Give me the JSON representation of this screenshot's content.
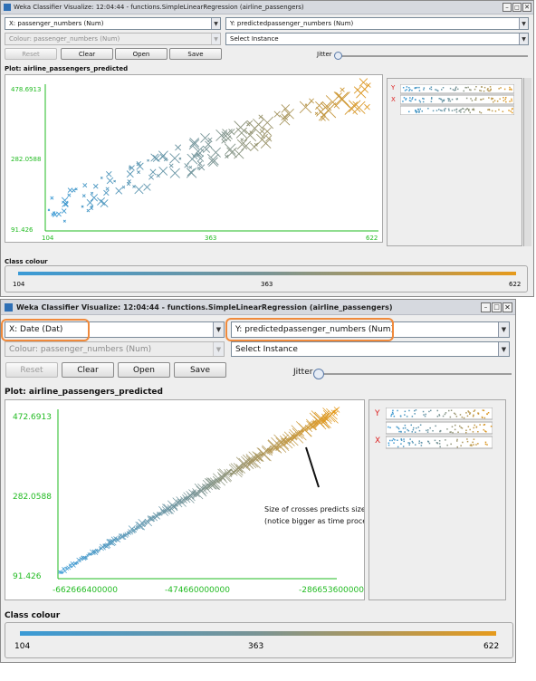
{
  "top_window": {
    "title": "Weka Classifier Visualize: 12:04:44 - functions.SimpleLinearRegression (airline_passengers)",
    "x_axis": "X: passenger_numbers (Num)",
    "y_axis": "Y: predictedpassenger_numbers (Num)",
    "colour": "Colour: passenger_numbers (Num)",
    "select_instance": "Select Instance",
    "buttons": {
      "reset": "Reset",
      "clear": "Clear",
      "open": "Open",
      "save": "Save"
    },
    "jitter": "Jitter",
    "plot_title": "Plot: airline_passengers_predicted",
    "y_ticks": [
      "478.6913",
      "282.0588",
      "91.426"
    ],
    "x_ticks": [
      "104",
      "363",
      "622"
    ],
    "legend_letters": [
      "Y",
      "X"
    ],
    "class_colour": "Class colour",
    "class_ticks": [
      "104",
      "363",
      "622"
    ]
  },
  "bottom_window": {
    "title": "Weka Classifier Visualize: 12:04:44 - functions.SimpleLinearRegression (airline_passengers)",
    "x_axis": "X: Date (Dat)",
    "y_axis": "Y: predictedpassenger_numbers (Num)",
    "colour": "Colour: passenger_numbers (Num)",
    "select_instance": "Select Instance",
    "buttons": {
      "reset": "Reset",
      "clear": "Clear",
      "open": "Open",
      "save": "Save"
    },
    "jitter": "Jitter",
    "plot_title": "Plot: airline_passengers_predicted",
    "y_ticks": [
      "472.6913",
      "282.0588",
      "91.426"
    ],
    "x_ticks": [
      "-662666400000",
      "-474660000000",
      "-286653600000"
    ],
    "legend_letters": [
      "Y",
      "X"
    ],
    "class_colour": "Class colour",
    "class_ticks": [
      "104",
      "363",
      "622"
    ],
    "annotation_lines": [
      "Size of crosses predicts size of error",
      "(notice bigger as time proceeds"
    ]
  },
  "colors": {
    "axis_green": "#22bb22",
    "low": "#3a9ad6",
    "mid": "#7a9494",
    "high": "#e69a1c",
    "annotation_orange": "#f08a3c"
  },
  "icons": {
    "minimize": "minimize-icon",
    "maximize": "maximize-icon",
    "close": "close-icon",
    "dropdown": "chevron-down-icon",
    "app": "weka-app-icon"
  }
}
